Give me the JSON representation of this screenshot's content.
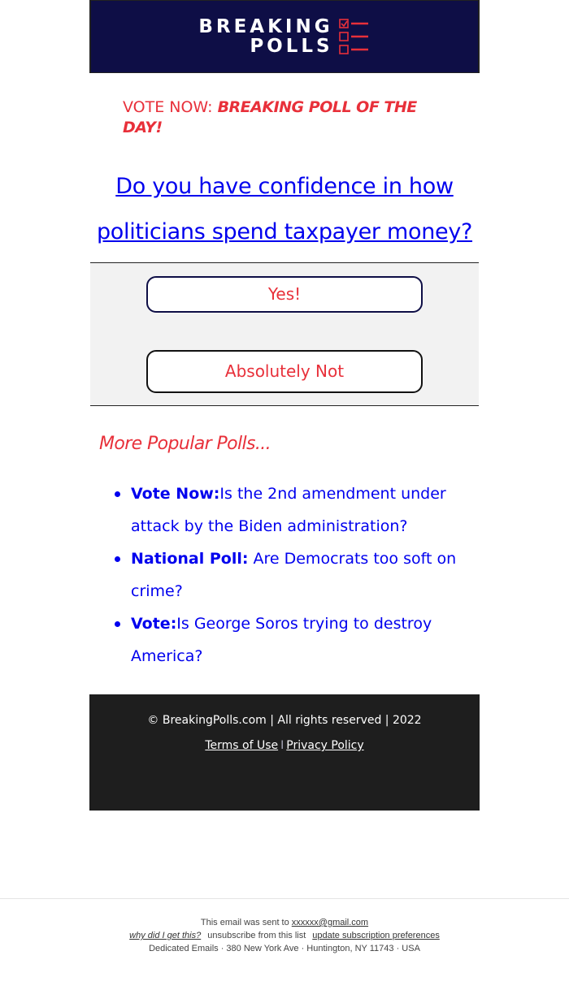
{
  "header": {
    "logo_line1": "BREAKING",
    "logo_line2": "POLLS",
    "logo_icon": "checklist-icon",
    "bg_color": "#0e0e46",
    "accent_color": "#e8303a"
  },
  "vote_now": {
    "lead": "VOTE NOW: ",
    "emphasis": "BREAKING POLL OF THE DAY!"
  },
  "question": {
    "text": "Do you have confidence in how politicians spend taxpayer money?"
  },
  "answers": [
    {
      "label": "Yes!"
    },
    {
      "label": "Absolutely Not"
    }
  ],
  "more_polls": {
    "title": "More Popular Polls...",
    "items": [
      {
        "prefix": "Vote Now:",
        "text": "Is the 2nd amendment under attack by the Biden administration?"
      },
      {
        "prefix": "National Poll:",
        "text": " Are Democrats too soft on crime?"
      },
      {
        "prefix": "Vote:",
        "text": "Is George Soros trying to destroy America?"
      }
    ]
  },
  "footer": {
    "copyright": "© BreakingPolls.com | All rights reserved | 2022",
    "terms_label": "Terms of Use",
    "separator": "I",
    "privacy_label": "Privacy Policy"
  },
  "legal": {
    "sent_to_prefix": "This email was sent to ",
    "email": "xxxxxx@gmail.com",
    "why_label": "why did I get this?",
    "unsubscribe_label": "unsubscribe from this list",
    "preferences_label": "update subscription preferences",
    "address": "Dedicated Emails · 380 New York Ave · Huntington, NY 11743 · USA"
  }
}
